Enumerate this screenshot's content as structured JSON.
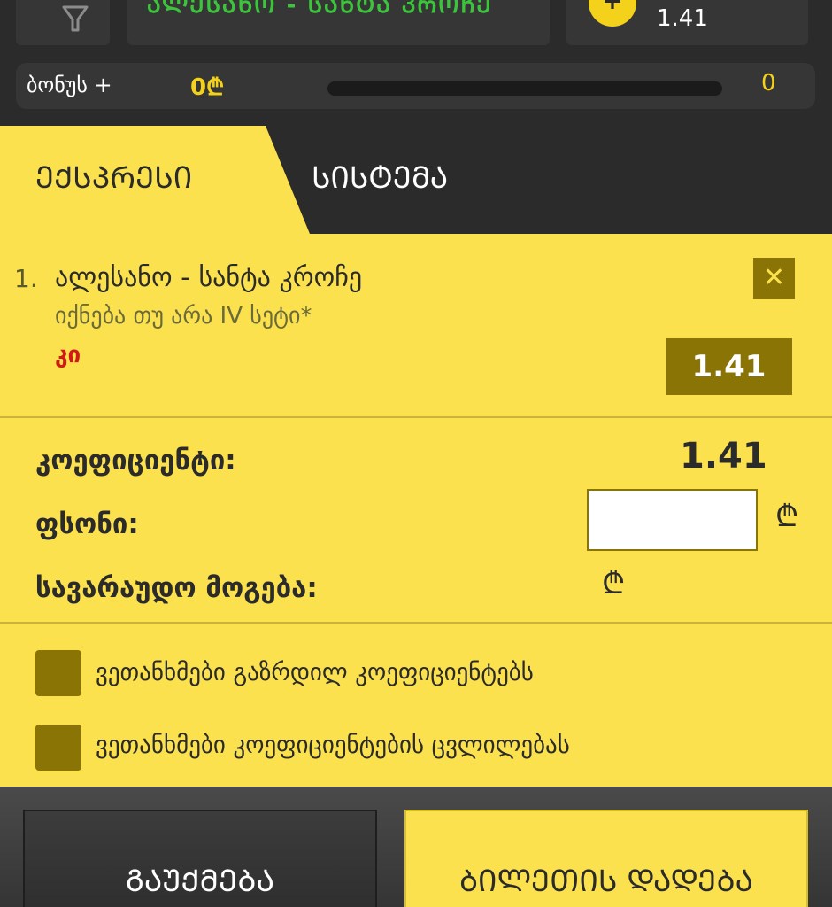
{
  "top": {
    "event_text": "ᲐᲚᲔᲡᲐᲜᲝ - ᲡᲐᲜᲢᲐ ᲙᲠᲝᲩᲔ",
    "plus_symbol": "+",
    "odds": "1.41"
  },
  "bonus": {
    "label": "ბონუს +",
    "amount": "0₾",
    "progress": 0,
    "count": "0"
  },
  "tabs": [
    {
      "label": "ᲔᲥᲡᲞᲠᲔᲡᲘ",
      "active": true
    },
    {
      "label": "ᲡᲘᲡᲢᲔᲛᲐ",
      "active": false
    }
  ],
  "bet": {
    "number": "1.",
    "match": "ალესანო - სანტა კროჩე",
    "market": "იქნება თუ არა IV სეტი*",
    "choice": "კი",
    "odds": "1.41",
    "remove_symbol": "✕"
  },
  "summary": {
    "coef_label": "კოეფიციენტი:",
    "coef_value": "1.41",
    "stake_label": "ფსონი:",
    "stake_value": "",
    "win_label": "სავარაუდო მოგება:",
    "currency": "₾"
  },
  "agreements": [
    {
      "label": "ვეთანხმები გაზრდილ კოეფიციენტებს",
      "checked": false
    },
    {
      "label": "ვეთანხმები კოეფიციენტების ცვლილებას",
      "checked": false
    }
  ],
  "footer": {
    "cancel_label": "ᲒᲐᲣᲥᲛᲔᲑᲐ",
    "place_label": "ᲑᲘᲚᲔᲗᲘᲡ ᲓᲐᲓᲔᲑᲐ"
  },
  "colors": {
    "accent": "#fce14f",
    "dark": "#2b2b2b",
    "olive": "#8a7406",
    "choice_red": "#d01a1a"
  }
}
